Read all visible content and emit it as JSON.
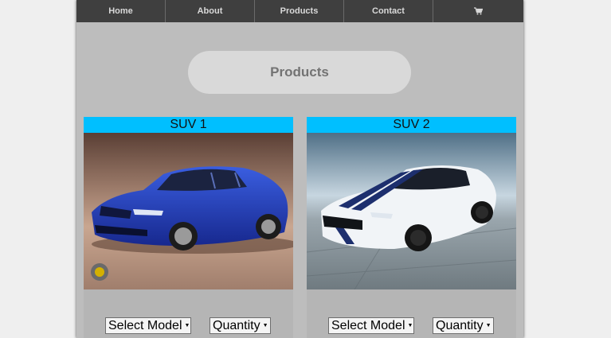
{
  "nav": {
    "items": [
      {
        "label": "Home"
      },
      {
        "label": "About"
      },
      {
        "label": "Products"
      },
      {
        "label": "Contact"
      }
    ],
    "cart_icon": "shopping-cart-icon"
  },
  "page_title": "Products",
  "products": [
    {
      "title": "SUV 1",
      "image": "blue sedan car photo",
      "model_select": "Select Model",
      "quantity_select": "Quantity"
    },
    {
      "title": "SUV 2",
      "image": "white sports car with blue stripes photo",
      "model_select": "Select Model",
      "quantity_select": "Quantity"
    }
  ],
  "colors": {
    "nav_bg": "#3f3f3f",
    "page_bg": "#bdbdbd",
    "card_header": "#00bfff",
    "pill_bg": "#d9d9d9"
  }
}
